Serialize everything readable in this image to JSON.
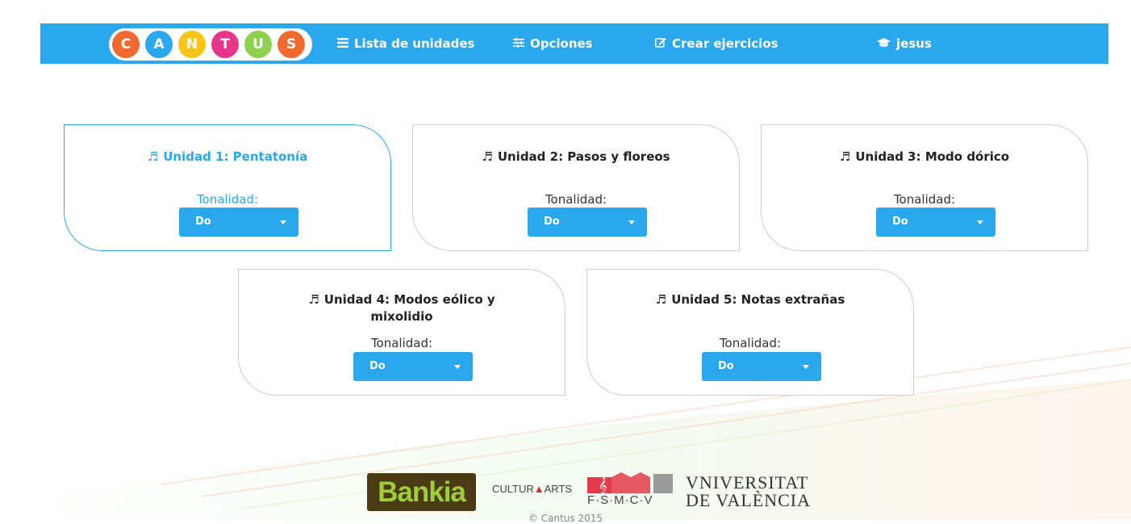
{
  "logo": {
    "letters": [
      "C",
      "A",
      "N",
      "T",
      "U",
      "S"
    ],
    "colors": [
      "#f06a30",
      "#2aa8ee",
      "#f5c518",
      "#e7368a",
      "#8fd14f",
      "#f06a30"
    ]
  },
  "nav": {
    "items": [
      {
        "icon": "list-icon",
        "label": "Lista de unidades"
      },
      {
        "icon": "sliders-icon",
        "label": "Opciones"
      },
      {
        "icon": "edit-icon",
        "label": "Crear ejercicios"
      },
      {
        "icon": "graduation-cap-icon",
        "label": "jesus"
      }
    ]
  },
  "units": [
    {
      "title": "Unidad 1: Pentatonía",
      "tonalidad_label": "Tonalidad:",
      "selected": "Do",
      "active": true
    },
    {
      "title": "Unidad 2: Pasos y floreos",
      "tonalidad_label": "Tonalidad:",
      "selected": "Do",
      "active": false
    },
    {
      "title": "Unidad 3: Modo dórico",
      "tonalidad_label": "Tonalidad:",
      "selected": "Do",
      "active": false
    },
    {
      "title": "Unidad 4: Modos eólico y mixolidio",
      "tonalidad_label": "Tonalidad:",
      "selected": "Do",
      "active": false
    },
    {
      "title": "Unidad 5: Notas extrañas",
      "tonalidad_label": "Tonalidad:",
      "selected": "Do",
      "active": false
    }
  ],
  "footer": {
    "bankia": "Bankia",
    "culturarts_a": "CULTUR",
    "culturarts_b": "ARTS",
    "fsmcv": "F·S·M·C·V",
    "universitat_line1": "VNIVERSITAT",
    "universitat_line2": "DE VALÈNCIA",
    "copyright": "© Cantus 2015"
  },
  "colors": {
    "accent": "#2aa8ee",
    "card_border": "#cccccc",
    "bankia_bg": "#4a3b14",
    "bankia_text": "#9fcd3a"
  }
}
